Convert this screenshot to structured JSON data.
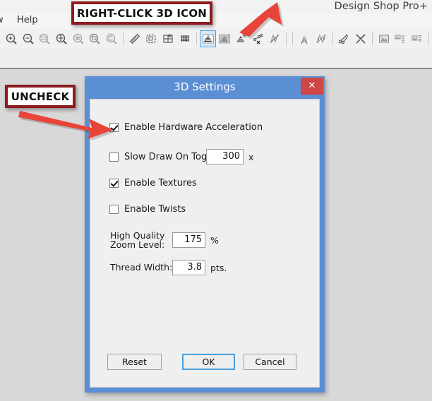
{
  "app": {
    "title": "Design Shop Pro+",
    "menu": [
      {
        "name": "menu-window",
        "label": "w"
      },
      {
        "name": "menu-help",
        "label": "Help"
      }
    ]
  },
  "toolbar": {
    "items": [
      {
        "name": "zoom-in-icon",
        "label": "zoom-in-icon",
        "active": false
      },
      {
        "name": "zoom-out-icon",
        "label": "zoom-out-icon",
        "active": false
      },
      {
        "name": "zoom-selection-icon",
        "label": "zoom-selection-icon",
        "active": false
      },
      {
        "name": "zoom-fit-icon",
        "label": "zoom-fit-icon",
        "active": false
      },
      {
        "name": "zoom-grid-icon",
        "label": "zoom-grid-icon",
        "active": false
      },
      {
        "name": "zoom-previous-icon",
        "label": "zoom-previous-icon",
        "active": false
      },
      {
        "name": "zoom-refresh-icon",
        "label": "zoom-refresh-icon",
        "active": false
      },
      {
        "name": "ruler-icon",
        "label": "ruler-icon",
        "active": false
      },
      {
        "name": "hoop-icon",
        "label": "hoop-icon",
        "active": false
      },
      {
        "name": "grid-quarters-icon",
        "label": "grid-quarters-icon",
        "active": false
      },
      {
        "name": "fine-grid-icon",
        "label": "fine-grid-icon",
        "active": false
      },
      {
        "name": "three-d-view-icon",
        "label": "three-d-view-icon",
        "active": true
      },
      {
        "name": "three-d-texture-icon",
        "label": "three-d-texture-icon",
        "active": false
      },
      {
        "name": "three-d-stitch-icon",
        "label": "three-d-stitch-icon",
        "active": false
      },
      {
        "name": "stitch-points-icon",
        "label": "stitch-points-icon",
        "active": false
      },
      {
        "name": "hide-stitches-icon",
        "label": "hide-stitches-icon",
        "active": false
      },
      {
        "name": "needle-icon",
        "label": "needle-icon",
        "active": false
      },
      {
        "name": "connectors-icon",
        "label": "connectors-icon",
        "active": false
      },
      {
        "name": "trim-icon",
        "label": "trim-icon",
        "active": false
      },
      {
        "name": "collapse-icon",
        "label": "collapse-icon",
        "active": false
      },
      {
        "name": "image-icon",
        "label": "image-icon",
        "active": false
      },
      {
        "name": "image-list-icon",
        "label": "image-list-icon",
        "active": false
      },
      {
        "name": "image-stack-icon",
        "label": "image-stack-icon",
        "active": false
      }
    ]
  },
  "dialog": {
    "title": "3D Settings",
    "close_label": "✕",
    "hardware_acceleration": {
      "label": "Enable Hardware Acceleration",
      "checked": true
    },
    "slow_draw": {
      "label": "Slow Draw On Toggle",
      "checked": false,
      "value": "300",
      "unit": "x"
    },
    "textures": {
      "label": "Enable Textures",
      "checked": true
    },
    "twists": {
      "label": "Enable Twists",
      "checked": false
    },
    "zoom_level": {
      "label": "High Quality\nZoom Level:",
      "value": "175",
      "unit": "%"
    },
    "thread_width": {
      "label": "Thread Width:",
      "value": "3.8",
      "unit": "pts."
    },
    "buttons": {
      "reset": "Reset",
      "ok": "OK",
      "cancel": "Cancel"
    }
  },
  "annotations": {
    "right_click": "RIGHT-CLICK 3D ICON",
    "uncheck": "UNCHECK"
  },
  "colors": {
    "dialog_chrome": "#5b8fd4",
    "close_button": "#cf4745",
    "annotation_border": "#8e1b20",
    "arrow": "#e8443a",
    "accent_focus": "#4a9ede"
  }
}
